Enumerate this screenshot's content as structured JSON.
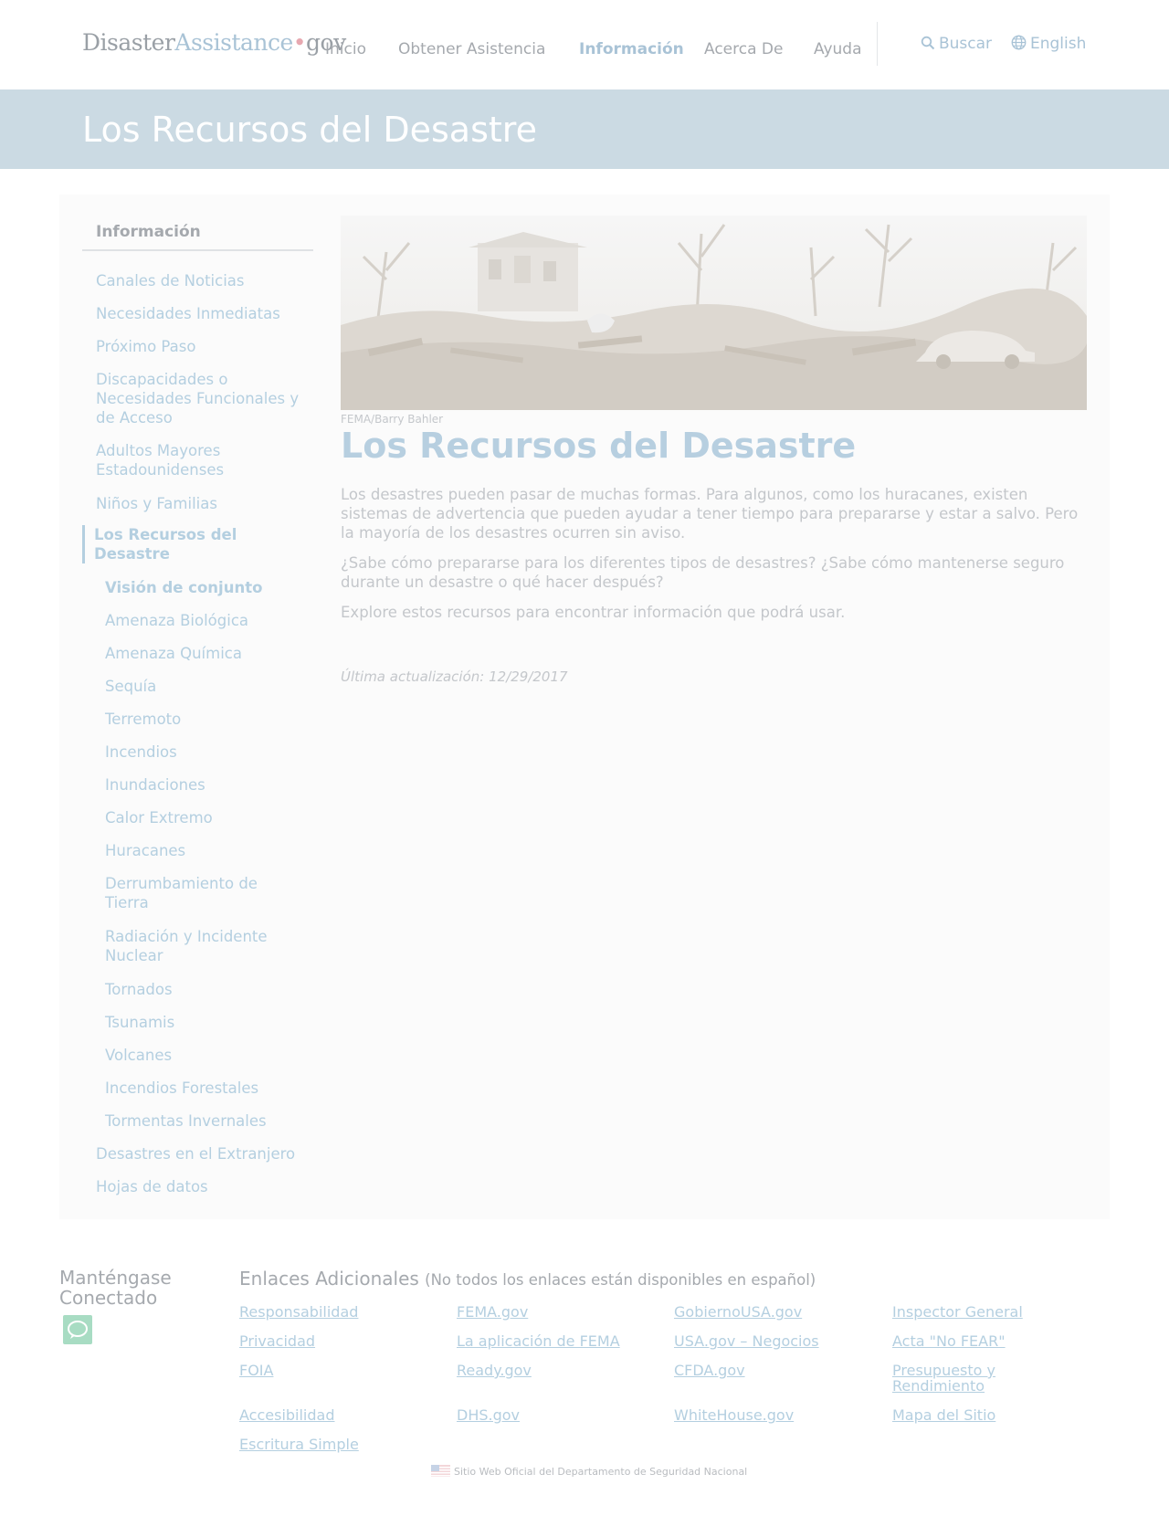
{
  "header": {
    "logo": {
      "part1": "Disaster",
      "part2": "Assistance",
      "dot": "•",
      "part3": "gov"
    },
    "nav": [
      {
        "label": "Inicio"
      },
      {
        "label": "Obtener Asistencia"
      },
      {
        "label": "Información",
        "active": true
      },
      {
        "label": "Acerca De"
      },
      {
        "label": "Ayuda"
      }
    ],
    "search_label": "Buscar",
    "language_label": "English"
  },
  "banner": {
    "title": "Los Recursos del Desastre"
  },
  "sidebar": {
    "title": "Información",
    "items": [
      {
        "label": "Canales de Noticias"
      },
      {
        "label": "Necesidades Inmediatas"
      },
      {
        "label": "Próximo Paso"
      },
      {
        "label": "Discapacidades o Necesidades Funcionales y de Acceso"
      },
      {
        "label": "Adultos Mayores Estadounidenses"
      },
      {
        "label": "Niños y Familias"
      },
      {
        "label": "Los Recursos del Desastre",
        "current": true
      }
    ],
    "subitems": [
      {
        "label": "Visión de conjunto",
        "current": true
      },
      {
        "label": "Amenaza Biológica"
      },
      {
        "label": "Amenaza Química"
      },
      {
        "label": "Sequía"
      },
      {
        "label": "Terremoto"
      },
      {
        "label": "Incendios"
      },
      {
        "label": "Inundaciones"
      },
      {
        "label": "Calor Extremo"
      },
      {
        "label": "Huracanes"
      },
      {
        "label": "Derrumbamiento de Tierra"
      },
      {
        "label": "Radiación y Incidente Nuclear"
      },
      {
        "label": "Tornados"
      },
      {
        "label": "Tsunamis"
      },
      {
        "label": "Volcanes"
      },
      {
        "label": "Incendios Forestales"
      },
      {
        "label": "Tormentas Invernales"
      }
    ],
    "after_items": [
      {
        "label": "Desastres en el Extranjero"
      },
      {
        "label": "Hojas de datos"
      }
    ]
  },
  "main": {
    "image_caption": "FEMA/Barry Bahler",
    "title": "Los Recursos del Desastre",
    "paragraphs": [
      "Los desastres pueden pasar de muchas formas. Para algunos, como los huracanes, existen sistemas de advertencia que pueden ayudar a tener tiempo para prepararse y estar a salvo. Pero la mayoría de los desastres ocurren sin aviso.",
      "¿Sabe cómo prepararse para los diferentes tipos de desastres? ¿Sabe cómo mantenerse seguro durante un desastre o qué hacer después?",
      "Explore estos recursos para encontrar información que podrá usar."
    ],
    "last_updated": "Última actualización: 12/29/2017"
  },
  "footer": {
    "connected_heading": "Manténgase Conectado",
    "links_title": "Enlaces Adicionales",
    "links_note": "(No todos los enlaces están disponibles en español)",
    "links": [
      "Responsabilidad",
      "FEMA.gov",
      "GobiernoUSA.gov",
      "Inspector General",
      "Privacidad",
      "La aplicación de FEMA",
      "USA.gov – Negocios",
      "Acta \"No FEAR\"",
      "FOIA",
      "Ready.gov",
      "CFDA.gov",
      "Presupuesto y Rendimiento",
      "Accesibilidad",
      "DHS.gov",
      "WhiteHouse.gov",
      "Mapa del Sitio",
      "Escritura Simple"
    ],
    "official_site": "Sitio Web Oficial del Departamento de Seguridad Nacional"
  }
}
